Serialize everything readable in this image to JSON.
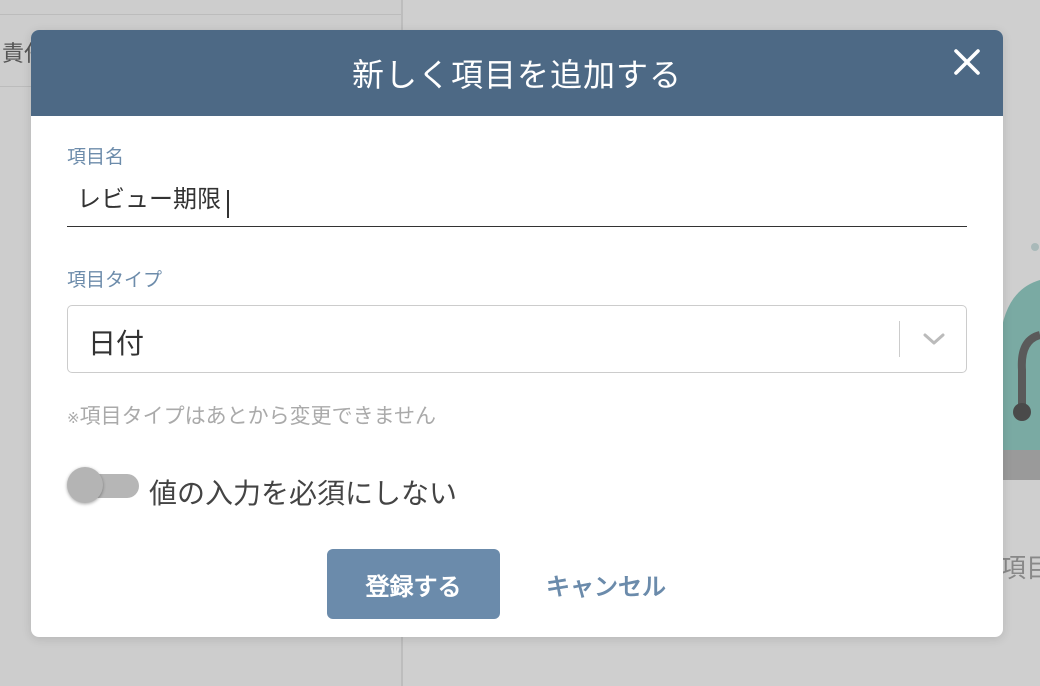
{
  "background": {
    "left_cell_text": "責任",
    "right_text": "項目"
  },
  "modal": {
    "title": "新しく項目を追加する",
    "close_icon": "close-icon",
    "name_field": {
      "label": "項目名",
      "value": "レビュー期限"
    },
    "type_field": {
      "label": "項目タイプ",
      "selected": "日付",
      "arrow_icon": "chevron-down-icon"
    },
    "note": {
      "mark": "※",
      "text": "項目タイプはあとから変更できません"
    },
    "required_toggle": {
      "label": "値の入力を必須にしない",
      "on": false
    },
    "submit_label": "登録する",
    "cancel_label": "キャンセル"
  },
  "colors": {
    "header": "#4d6985",
    "accent": "#6b8bab",
    "label": "#6d8cab"
  }
}
